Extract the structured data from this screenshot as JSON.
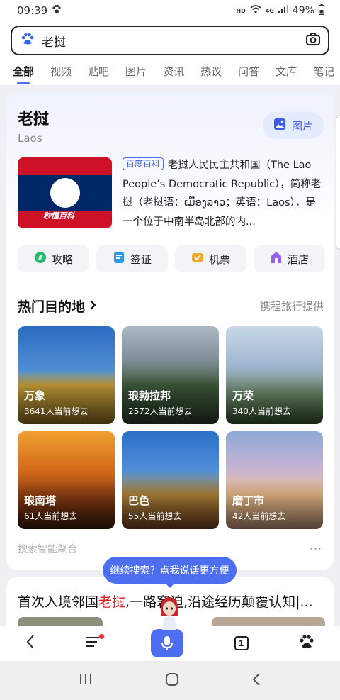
{
  "status_bar": {
    "time": "09:39",
    "hd": "HD",
    "network": "4G",
    "battery": "49%"
  },
  "search": {
    "query": "老挝"
  },
  "tabs": [
    "全部",
    "视频",
    "贴吧",
    "图片",
    "资讯",
    "热议",
    "问答",
    "文库",
    "笔记"
  ],
  "entity": {
    "title": "老挝",
    "subtitle": "Laos",
    "image_button": "图片",
    "flag_watermark": "秒懂百科",
    "badge": "百度百科",
    "abstract": "老挝人民民主共和国（The Lao People’s Democratic Republic），简称老挝（老挝语：ເມືອງລາວ；英语：Laos），是一个位于中南半岛北部的内..."
  },
  "chips": [
    {
      "label": "攻略",
      "icon": "guide-icon",
      "color": "#2bb673"
    },
    {
      "label": "签证",
      "icon": "visa-icon",
      "color": "#2f9be8"
    },
    {
      "label": "机票",
      "icon": "ticket-icon",
      "color": "#f5a623"
    },
    {
      "label": "酒店",
      "icon": "hotel-icon",
      "color": "#9b5cf0"
    }
  ],
  "destinations_section": {
    "title": "热门目的地",
    "source": "携程旅行提供",
    "items": [
      {
        "name": "万象",
        "count": "3641人当前想去"
      },
      {
        "name": "琅勃拉邦",
        "count": "2572人当前想去"
      },
      {
        "name": "万荣",
        "count": "340人当前想去"
      },
      {
        "name": "琅南塔",
        "count": "61人当前想去"
      },
      {
        "name": "巴色",
        "count": "55人当前想去"
      },
      {
        "name": "磨丁市",
        "count": "42人当前想去"
      }
    ],
    "footer": "搜索智能聚合",
    "more": "···"
  },
  "tooltip": "继续搜索？点我说话更方便",
  "news": {
    "title_prefix": "首次入境邻国",
    "title_highlight": "老挝",
    "title_suffix": ",一路窘迫,沿途经历颠覆认知|..."
  },
  "bottom_nav": {
    "tabs_count": "1"
  },
  "colors": {
    "accent": "#4e6ef2",
    "highlight": "#e02020"
  }
}
